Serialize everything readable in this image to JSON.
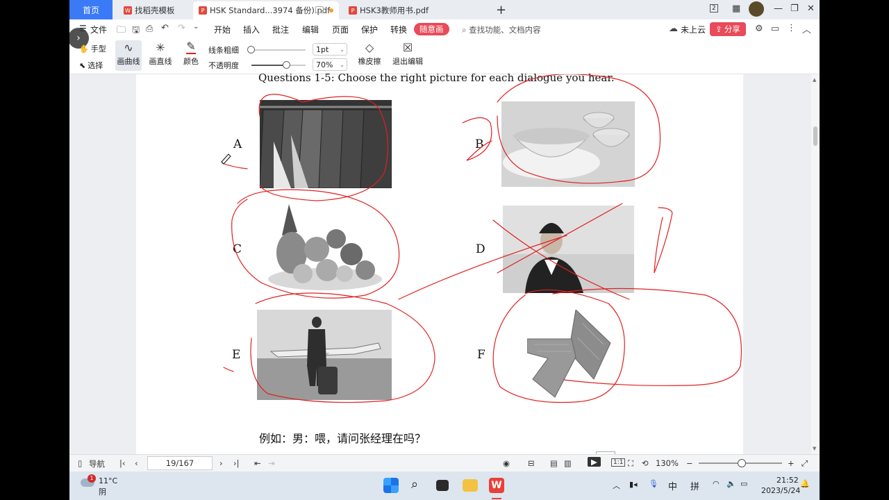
{
  "tabs": {
    "home": "首页",
    "items": [
      {
        "label": "找稻壳模板",
        "active": false
      },
      {
        "label": "HSK Standard...3974 备份).pdf",
        "active": true
      },
      {
        "label": "HSK3教师用书.pdf",
        "active": false
      }
    ],
    "badge": "2"
  },
  "menu": {
    "file": "文件",
    "items": [
      "开始",
      "插入",
      "批注",
      "编辑",
      "页面",
      "保护",
      "转换"
    ],
    "special": "随意画",
    "search_placeholder": "查找功能、文档内容",
    "cloud": "未上云",
    "share": "分享"
  },
  "ink_toolbar": {
    "hand": "手型",
    "select": "选择",
    "curve": "画曲线",
    "line": "画直线",
    "color": "颜色",
    "thickness_label": "线条粗细",
    "thickness_value": "1pt",
    "opacity_label": "不透明度",
    "opacity_value": "70%",
    "eraser": "橡皮擦",
    "exit": "退出编辑",
    "ink_color": "#e02020"
  },
  "document": {
    "question": "Questions 1-5: Choose the right picture for each dialogue you hear.",
    "letters": [
      "A",
      "B",
      "C",
      "D",
      "E",
      "F"
    ],
    "example": "例如：男：喂，请问张经理在吗？"
  },
  "statusbar": {
    "nav": "导航",
    "page": "19/167",
    "zoom": "130%"
  },
  "taskbar": {
    "weather_temp": "11°C",
    "weather_desc": "阴",
    "weather_badge": "1",
    "ime1": "中",
    "ime2": "拼",
    "time": "21:52",
    "date": "2023/5/24"
  }
}
